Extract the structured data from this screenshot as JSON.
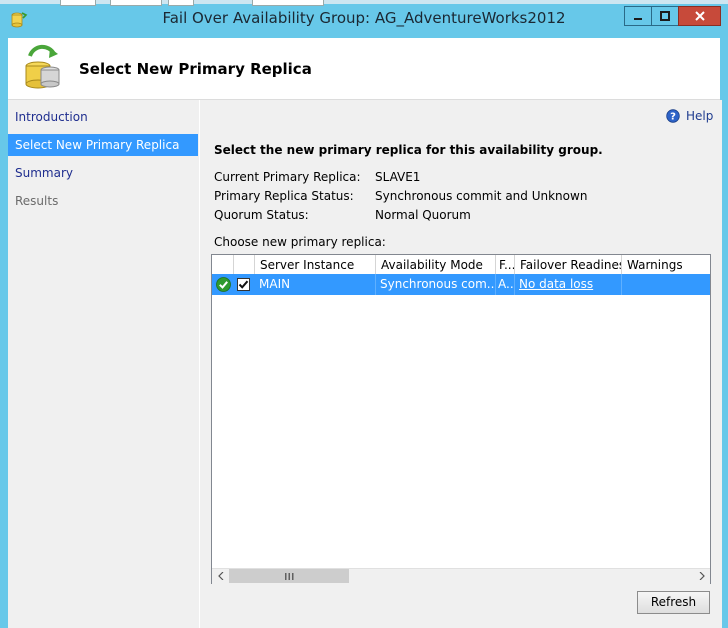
{
  "window": {
    "title": "Fail Over Availability Group: AG_AdventureWorks2012"
  },
  "header": {
    "title": "Select New Primary Replica"
  },
  "nav": {
    "items": [
      {
        "label": "Introduction",
        "state": "link"
      },
      {
        "label": "Select New Primary Replica",
        "state": "selected"
      },
      {
        "label": "Summary",
        "state": "link"
      },
      {
        "label": "Results",
        "state": "disabled"
      }
    ]
  },
  "help": {
    "label": "Help"
  },
  "main": {
    "instruction": "Select the new primary replica for this availability group.",
    "info": [
      {
        "label": "Current Primary Replica:",
        "value": "SLAVE1"
      },
      {
        "label": "Primary Replica Status:",
        "value": "Synchronous commit and Unknown"
      },
      {
        "label": "Quorum Status:",
        "value": "Normal Quorum"
      }
    ],
    "choose_label": "Choose new primary replica:"
  },
  "grid": {
    "columns": [
      "Server Instance",
      "Availability Mode",
      "F...",
      "Failover Readiness",
      "Warnings"
    ],
    "rows": [
      {
        "checked": true,
        "server_instance": "MAIN",
        "availability_mode": "Synchronous com...",
        "failover_mode": "A...",
        "failover_readiness": "No data loss",
        "warnings": ""
      }
    ]
  },
  "buttons": {
    "refresh": "Refresh"
  },
  "colors": {
    "titlebar": "#67c8e9",
    "selection": "#3399ff",
    "close": "#c74a3a"
  }
}
